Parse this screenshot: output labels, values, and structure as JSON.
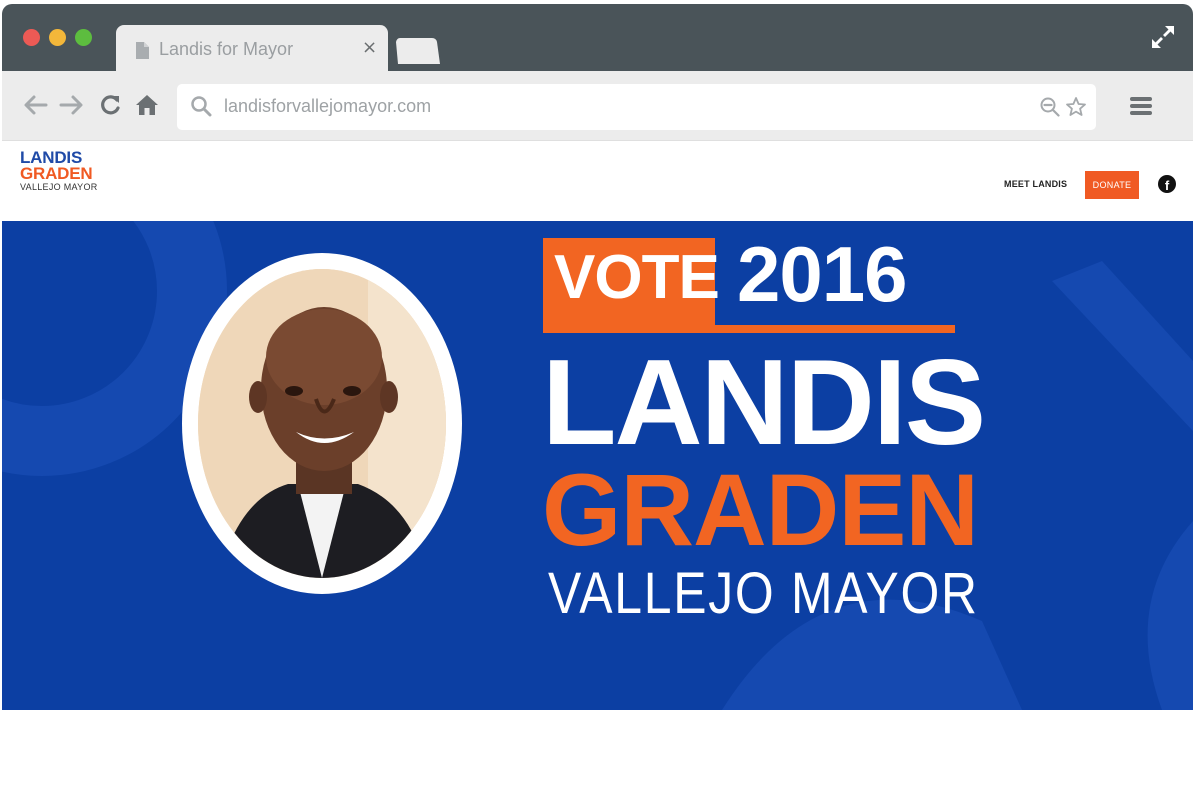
{
  "browser": {
    "tab_title": "Landis for Mayor",
    "tab_close": "×",
    "url": "landisforvallejomayor.com"
  },
  "site": {
    "logo": {
      "line1": "LANDIS",
      "line2": "GRADEN",
      "line3": "VALLEJO MAYOR"
    },
    "nav": {
      "meet": "MEET LANDIS",
      "donate": "DONATE",
      "facebook": "f"
    }
  },
  "hero": {
    "vote": "VOTE",
    "year": "2016",
    "first_name": "LANDIS",
    "last_name": "GRADEN",
    "subtitle": "VALLEJO MAYOR"
  },
  "colors": {
    "brand_blue": "#0c3fa3",
    "brand_orange": "#f26522",
    "titlebar": "#4a5459"
  },
  "icons": [
    "document-icon",
    "close-icon",
    "new-tab-icon",
    "expand-icon",
    "back-icon",
    "forward-icon",
    "reload-icon",
    "home-icon",
    "search-icon",
    "zoom-out-icon",
    "star-icon",
    "menu-icon",
    "facebook-icon"
  ]
}
